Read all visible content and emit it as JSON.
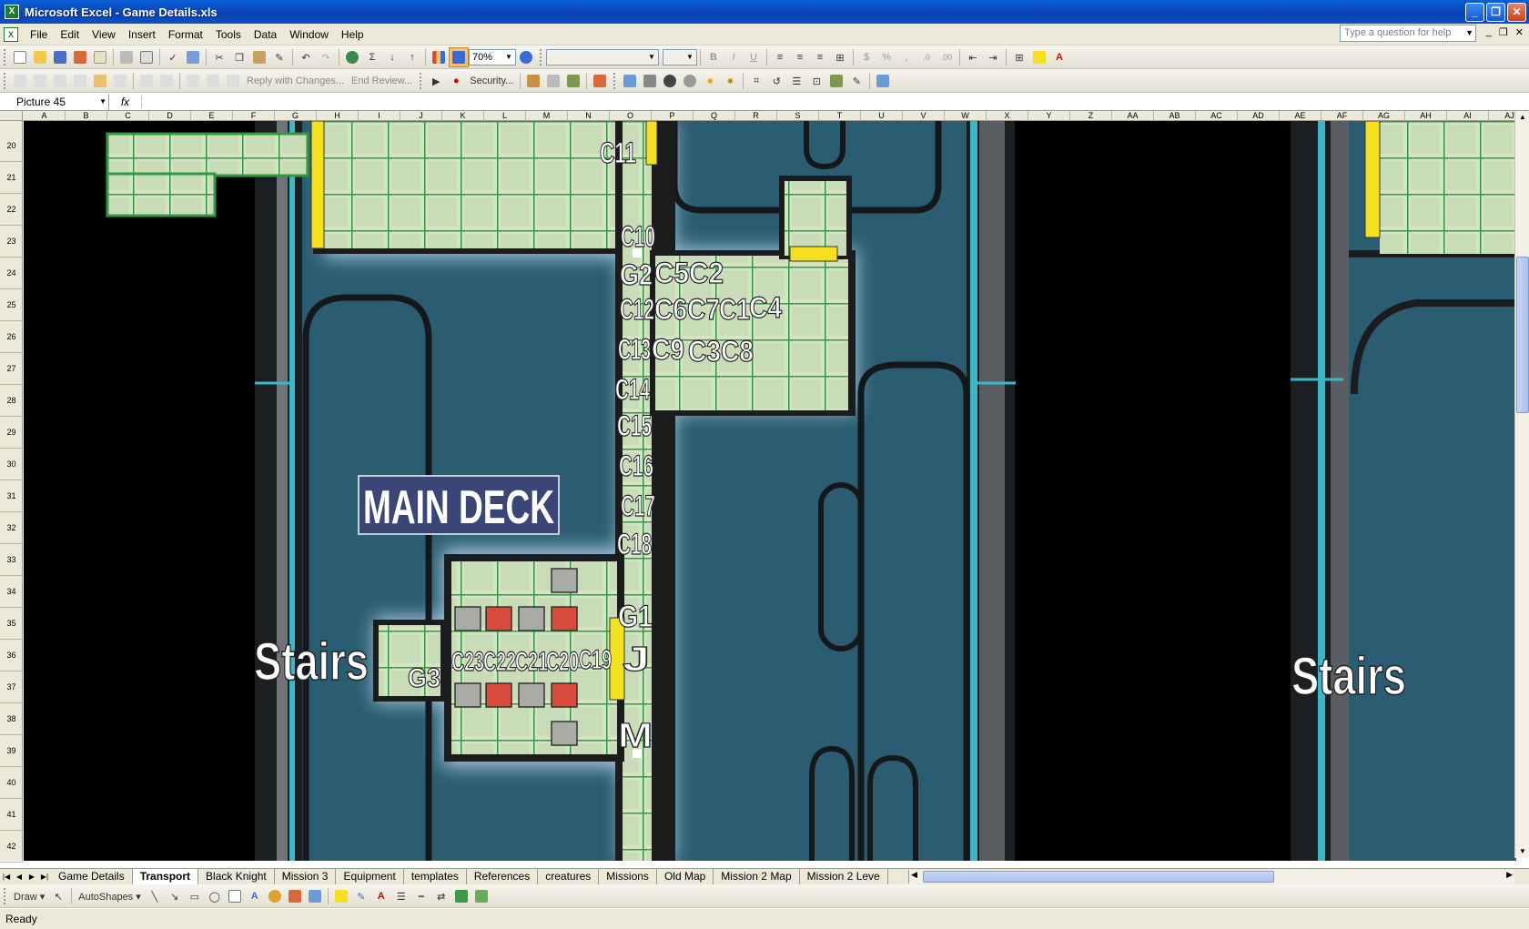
{
  "window": {
    "title": "Microsoft Excel - Game Details.xls"
  },
  "menu": [
    "File",
    "Edit",
    "View",
    "Insert",
    "Format",
    "Tools",
    "Data",
    "Window",
    "Help"
  ],
  "help_box": {
    "placeholder": "Type a question for help"
  },
  "toolbar": {
    "zoom": "70%",
    "reply_with_changes": "Reply with Changes...",
    "end_review": "End Review...",
    "security": "Security..."
  },
  "formula_bar": {
    "name_box": "Picture 45",
    "fx": "fx"
  },
  "columns": [
    "A",
    "B",
    "C",
    "D",
    "E",
    "F",
    "G",
    "H",
    "I",
    "J",
    "K",
    "L",
    "M",
    "N",
    "O",
    "P",
    "Q",
    "R",
    "S",
    "T",
    "U",
    "V",
    "W",
    "X",
    "Y",
    "Z",
    "AA",
    "AB",
    "AC",
    "AD",
    "AE",
    "AF",
    "AG",
    "AH",
    "AI",
    "AJ"
  ],
  "rows": [
    "20",
    "21",
    "22",
    "23",
    "24",
    "25",
    "26",
    "27",
    "28",
    "29",
    "30",
    "31",
    "32",
    "33",
    "34",
    "35",
    "36",
    "37",
    "38",
    "39",
    "40",
    "41",
    "42"
  ],
  "map": {
    "title": "MAIN DECK",
    "stairs_left": "Stairs",
    "stairs_right": "Stairs",
    "labels": {
      "c11": "C11",
      "c10": "C10",
      "g2": "G2",
      "c5": "C5",
      "c2": "C2",
      "c12": "C12",
      "c6": "C6",
      "c7": "C7",
      "c1": "C1",
      "c4": "C4",
      "c13": "C13",
      "c9": "C9",
      "c3": "C3",
      "c8": "C8",
      "c14": "C14",
      "c15": "C15",
      "c16": "C16",
      "c17": "C17",
      "c18": "C18",
      "g1": "G1",
      "j": "J",
      "m": "M",
      "g3": "G3",
      "c19": "C19",
      "c20": "C20",
      "c21": "C21",
      "c22": "C22",
      "c23": "C23"
    }
  },
  "sheet_tabs": [
    {
      "label": "Game Details",
      "active": false
    },
    {
      "label": "Transport",
      "active": true
    },
    {
      "label": "Black Knight",
      "active": false
    },
    {
      "label": "Mission 3",
      "active": false
    },
    {
      "label": "Equipment",
      "active": false
    },
    {
      "label": "templates",
      "active": false
    },
    {
      "label": "References",
      "active": false
    },
    {
      "label": "creatures",
      "active": false
    },
    {
      "label": "Missions",
      "active": false
    },
    {
      "label": "Old Map",
      "active": false
    },
    {
      "label": "Mission 2 Map",
      "active": false
    },
    {
      "label": "Mission 2 Leve",
      "active": false
    }
  ],
  "drawbar": {
    "draw": "Draw",
    "autoshapes": "AutoShapes"
  },
  "status": "Ready",
  "colors": {
    "floor": "#d4e4c4",
    "grid": "#2f9a3f",
    "water": "#2b5d72",
    "door": "#f4e01c",
    "crate_red": "#d84a3a",
    "crate_grey": "#a8aca4",
    "title_bg": "#3a4676"
  }
}
